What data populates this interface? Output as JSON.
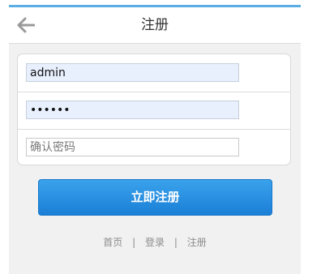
{
  "header": {
    "title": "注册",
    "back_icon": "arrow-left-icon"
  },
  "form": {
    "username": {
      "value": "admin",
      "placeholder": ""
    },
    "password": {
      "value": "123456",
      "placeholder": ""
    },
    "confirm_password": {
      "value": "",
      "placeholder": "确认密码"
    }
  },
  "submit": {
    "label": "立即注册"
  },
  "footer": {
    "links": [
      "首页",
      "登录",
      "注册"
    ],
    "separator": "|"
  },
  "colors": {
    "accent": "#1a7fd6",
    "top_line": "#5aaee3",
    "autofill_bg": "#e8f0fe"
  }
}
